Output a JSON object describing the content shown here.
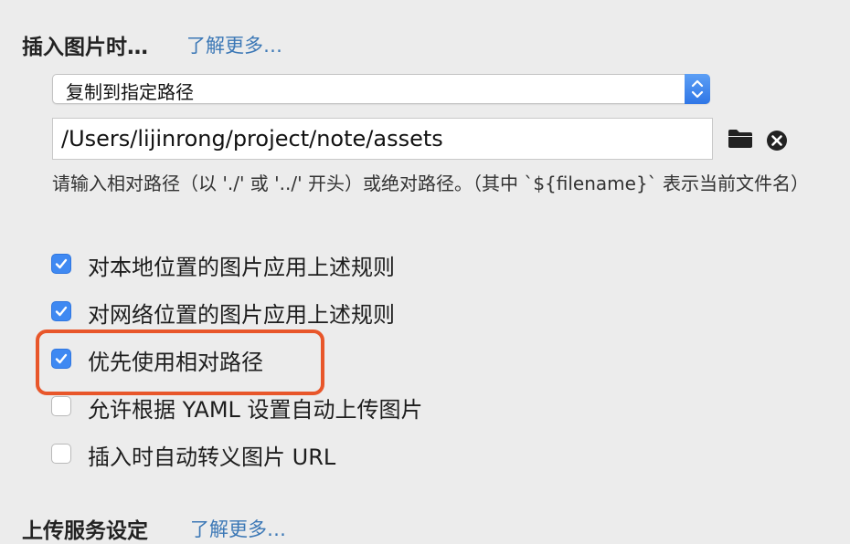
{
  "insert_image": {
    "title": "插入图片时…",
    "learn_more": "了解更多…",
    "select_value": "复制到指定路径",
    "path_value": "/Users/lijinrong/project/note/assets",
    "help_text": "请输入相对路径（以 './' 或 '../' 开头）或绝对路径。（其中 `${filename}` 表示当前文件名）"
  },
  "options": [
    {
      "label": "对本地位置的图片应用上述规则",
      "checked": true
    },
    {
      "label": "对网络位置的图片应用上述规则",
      "checked": true
    },
    {
      "label": "优先使用相对路径",
      "checked": true
    },
    {
      "label": "允许根据 YAML 设置自动上传图片",
      "checked": false
    },
    {
      "label": "插入时自动转义图片 URL",
      "checked": false
    }
  ],
  "upload_service": {
    "title": "上传服务设定",
    "learn_more": "了解更多…"
  },
  "colors": {
    "accent": "#3f89f2",
    "highlight": "#e8562a",
    "link": "#3c78b6"
  },
  "icons": {
    "select_arrows": "chevron-up-down-icon",
    "folder": "folder-icon",
    "clear": "close-circle-icon",
    "checkmark": "checkmark-icon"
  }
}
